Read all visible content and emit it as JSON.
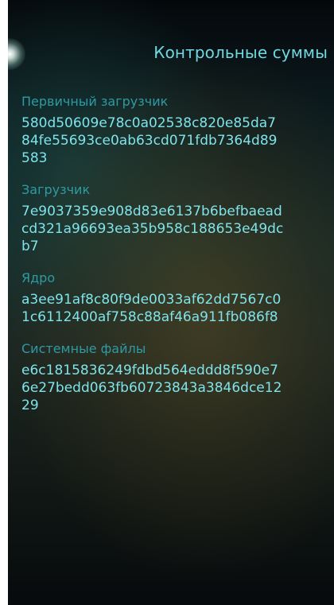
{
  "header": {
    "title": "Контрольные суммы"
  },
  "checksums": [
    {
      "label": "Первичный загрузчик",
      "line1": "580d50609e78c0a02538c820e85da7",
      "line2": "84fe55693ce0ab63cd071fdb7364d89",
      "line3": "583"
    },
    {
      "label": "Загрузчик",
      "line1": "7e9037359e908d83e6137b6befbaead",
      "line2": "cd321a96693ea35b958c188653e49dc",
      "line3": "b7"
    },
    {
      "label": "Ядро",
      "line1": "a3ee91af8c80f9de0033af62dd7567c0",
      "line2": "1c6112400af758c88af46a911fb086f8",
      "line3": ""
    },
    {
      "label": "Системные файлы",
      "line1": "e6c1815836249fdbd564eddd8f590e7",
      "line2": "6e27bedd063fb60723843a3846dce12",
      "line3": "29"
    }
  ],
  "colors": {
    "title": "#6fd8e0",
    "label": "#2f9aa3",
    "hash": "#7fe3ea"
  }
}
